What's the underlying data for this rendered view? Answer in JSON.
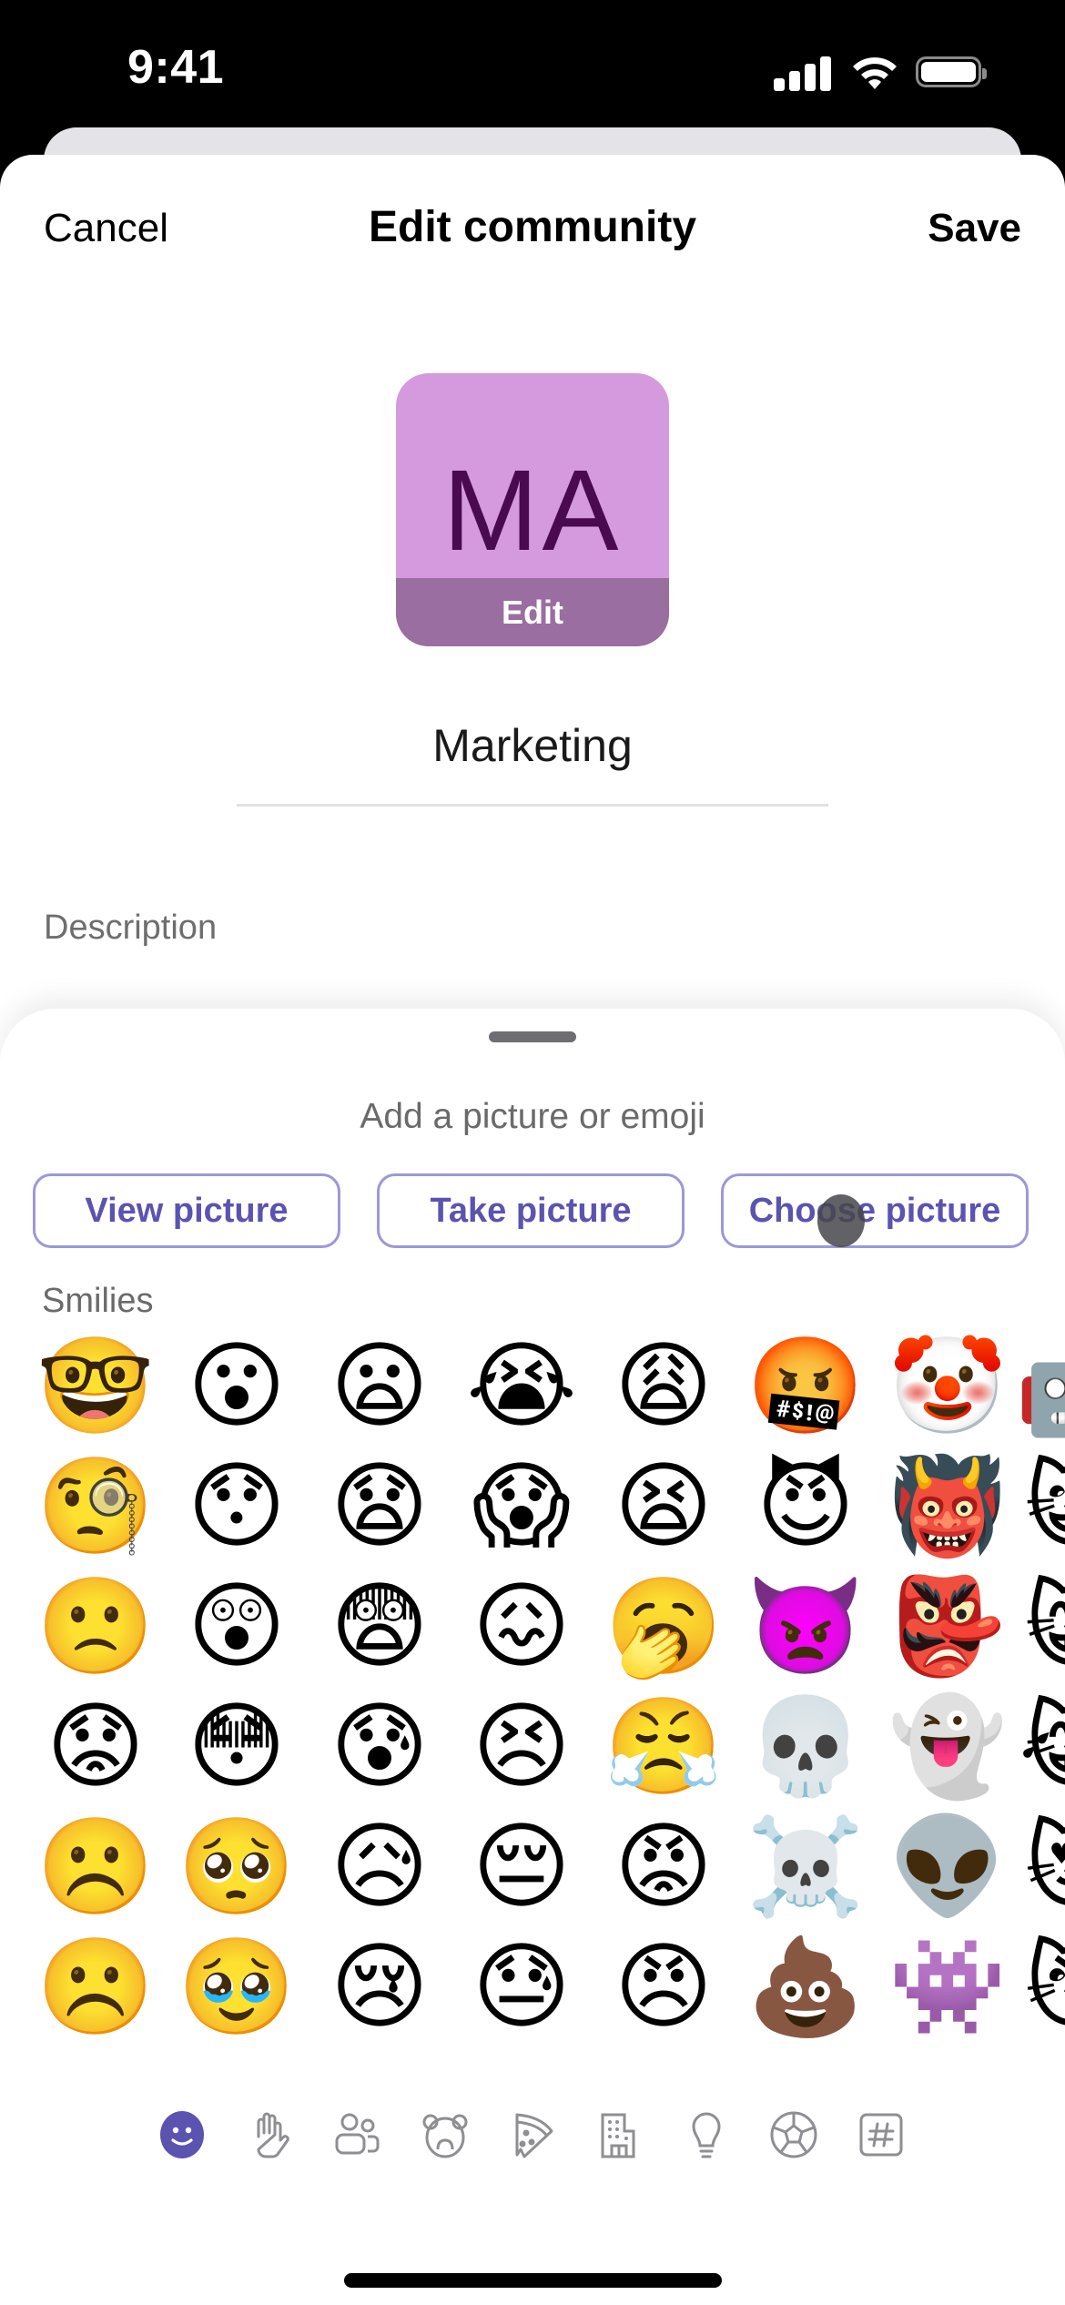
{
  "status_bar": {
    "time": "9:41",
    "icons": [
      "cellular-signal-icon",
      "wifi-icon",
      "battery-icon"
    ]
  },
  "nav": {
    "cancel_label": "Cancel",
    "title": "Edit community",
    "save_label": "Save"
  },
  "avatar": {
    "initials": "MA",
    "edit_label": "Edit",
    "background_color": "#d59ade",
    "initials_color": "#4a0a50",
    "edit_band_color": "#9a6ea0"
  },
  "community": {
    "name": "Marketing",
    "description_label": "Description"
  },
  "picker": {
    "title": "Add a picture or emoji",
    "buttons": [
      {
        "label": "View picture"
      },
      {
        "label": "Take picture"
      },
      {
        "label": "Choose picture"
      }
    ],
    "accent_color": "#5b53b0",
    "section_label": "Smilies",
    "emoji_rows": [
      [
        "🤓",
        "😮",
        "😦",
        "😭",
        "😩",
        "🤬",
        "🤡",
        "🤖"
      ],
      [
        "🧐",
        "😯",
        "😧",
        "😱",
        "😫",
        "😈",
        "👹",
        "😺"
      ],
      [
        "🙁",
        "😲",
        "😨",
        "😖",
        "🥱",
        "👿",
        "👺",
        "😸"
      ],
      [
        "😟",
        "😳",
        "😰",
        "😣",
        "😤",
        "💀",
        "👻",
        "😹"
      ],
      [
        "☹️",
        "🥺",
        "😥",
        "😔",
        "😡",
        "☠️",
        "👽",
        "😻"
      ],
      [
        "☹️",
        "🥹",
        "😢",
        "😓",
        "😠",
        "💩",
        "👾",
        "😼"
      ]
    ],
    "categories": [
      {
        "name": "smilies",
        "icon": "smiley-icon",
        "selected": true
      },
      {
        "name": "people-gestures",
        "icon": "hand-icon",
        "selected": false
      },
      {
        "name": "people",
        "icon": "people-icon",
        "selected": false
      },
      {
        "name": "animals",
        "icon": "bear-icon",
        "selected": false
      },
      {
        "name": "food",
        "icon": "pizza-icon",
        "selected": false
      },
      {
        "name": "places",
        "icon": "building-icon",
        "selected": false
      },
      {
        "name": "objects",
        "icon": "lightbulb-icon",
        "selected": false
      },
      {
        "name": "activities",
        "icon": "soccer-ball-icon",
        "selected": false
      },
      {
        "name": "symbols",
        "icon": "hashtag-icon",
        "selected": false
      }
    ]
  }
}
